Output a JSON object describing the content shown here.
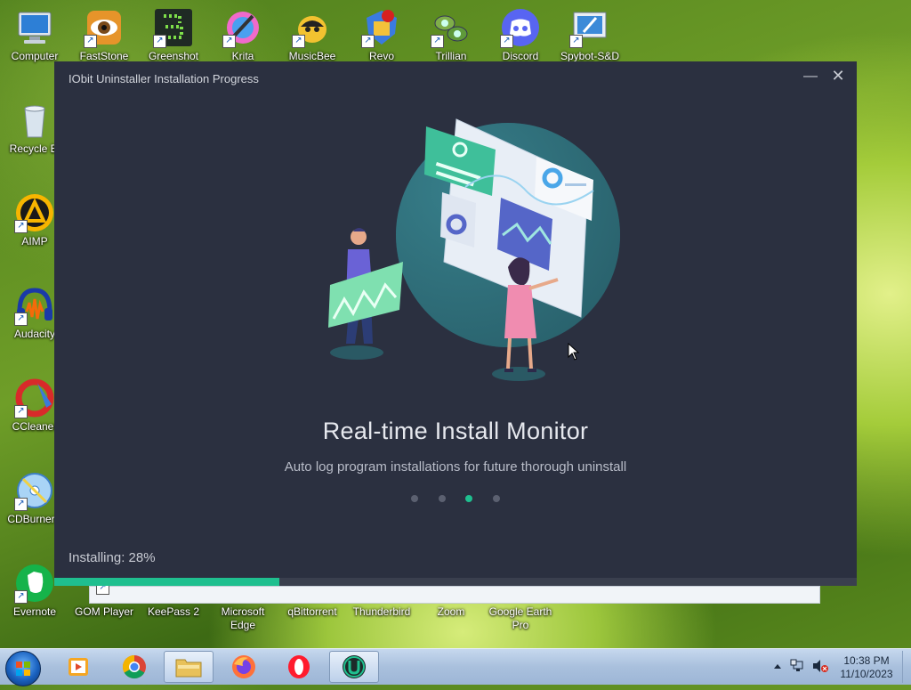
{
  "desktop": {
    "top_row": [
      {
        "label": "Computer",
        "icon": "computer-icon"
      },
      {
        "label": "FastStone",
        "icon": "faststone-icon"
      },
      {
        "label": "Greenshot",
        "icon": "greenshot-icon"
      },
      {
        "label": "Krita",
        "icon": "krita-icon"
      },
      {
        "label": "MusicBee",
        "icon": "musicbee-icon"
      },
      {
        "label": "Revo",
        "icon": "revo-icon"
      },
      {
        "label": "Trillian",
        "icon": "trillian-icon"
      },
      {
        "label": "Discord",
        "icon": "discord-icon"
      },
      {
        "label": "Spybot-S&D",
        "icon": "spybot-icon"
      }
    ],
    "left_col": [
      {
        "label": "Recycle Bi",
        "icon": "recycle-bin-icon"
      },
      {
        "label": "AIMP",
        "icon": "aimp-icon"
      },
      {
        "label": "Audacity",
        "icon": "audacity-icon"
      },
      {
        "label": "CCleaner",
        "icon": "ccleaner-icon"
      },
      {
        "label": "CDBurnerX",
        "icon": "cdburnerxp-icon"
      }
    ],
    "bottom_row": [
      {
        "label": "Evernote",
        "icon": "evernote-icon"
      },
      {
        "label": "GOM Player",
        "icon": "gom-player-icon"
      },
      {
        "label": "KeePass 2",
        "icon": "keepass-icon"
      },
      {
        "label": "Microsoft Edge",
        "icon": "edge-icon"
      },
      {
        "label": "qBittorrent",
        "icon": "qbittorrent-icon"
      },
      {
        "label": "Thunderbird",
        "icon": "thunderbird-icon"
      },
      {
        "label": "Zoom",
        "icon": "zoom-icon"
      },
      {
        "label": "Google Earth Pro",
        "icon": "google-earth-icon"
      }
    ]
  },
  "installer": {
    "title": "IObit Uninstaller Installation Progress",
    "minimize_glyph": "—",
    "close_glyph": "✕",
    "headline": "Real-time Install Monitor",
    "subline": "Auto log program installations for future thorough uninstall",
    "slides": 4,
    "active_slide": 3,
    "status": "Installing: 28%",
    "progress": 0.28,
    "accent": "#1fbf8f"
  },
  "taskbar": {
    "apps": [
      {
        "name": "windows-media-player",
        "icon": "media-player-icon"
      },
      {
        "name": "chrome",
        "icon": "chrome-icon"
      },
      {
        "name": "explorer",
        "icon": "folder-icon"
      },
      {
        "name": "firefox",
        "icon": "firefox-icon"
      },
      {
        "name": "opera",
        "icon": "opera-icon"
      },
      {
        "name": "iobit-uninstaller",
        "icon": "iobit-uninstaller-icon",
        "active": true
      }
    ],
    "time": "10:38 PM",
    "date": "11/10/2023"
  }
}
